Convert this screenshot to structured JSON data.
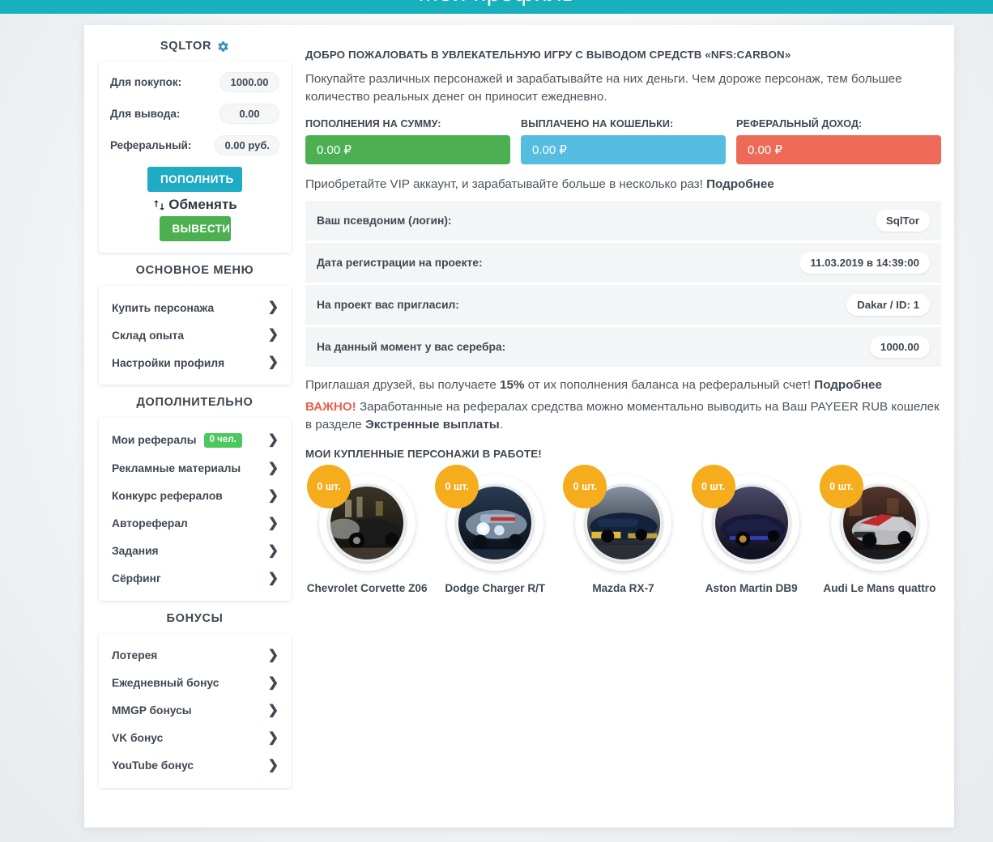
{
  "header": {
    "title": "Мой профиль",
    "accent_color": "#18b0bd"
  },
  "sidebar": {
    "brand": {
      "name": "SQLTOR",
      "gear_icon": "gear-icon"
    },
    "balance": {
      "rows": [
        {
          "label": "Для покупок:",
          "value": "1000.00"
        },
        {
          "label": "Для вывода:",
          "value": "0.00"
        },
        {
          "label": "Реферальный:",
          "value": "0.00 руб."
        }
      ],
      "topup_button": "ПОПОЛНИТЬ",
      "exchange_link": "Обменять",
      "withdraw_button": "ВЫВЕСТИ"
    },
    "sections": [
      {
        "title": "ОСНОВНОЕ МЕНЮ",
        "items": [
          {
            "label": "Купить персонажа"
          },
          {
            "label": "Склад опыта"
          },
          {
            "label": "Настройки профиля"
          }
        ]
      },
      {
        "title": "ДОПОЛНИТЕЛЬНО",
        "items": [
          {
            "label": "Мои рефералы",
            "badge": "0 чел."
          },
          {
            "label": "Рекламные материалы"
          },
          {
            "label": "Конкурс рефералов"
          },
          {
            "label": "Автореферал"
          },
          {
            "label": "Задания"
          },
          {
            "label": "Сёрфинг"
          }
        ]
      },
      {
        "title": "БОНУСЫ",
        "items": [
          {
            "label": "Лотерея"
          },
          {
            "label": "Ежедневный бонус"
          },
          {
            "label": "MMGP бонусы"
          },
          {
            "label": "VK бонус"
          },
          {
            "label": "YouTube бонус"
          }
        ]
      }
    ]
  },
  "main": {
    "welcome_title": "ДОБРО ПОЖАЛОВАТЬ В УВЛЕКАТЕЛЬНУЮ ИГРУ С ВЫВОДОМ СРЕДСТВ «NFS:CARBON»",
    "lead": "Покупайте различных персонажей и зарабатывайте на них деньги. Чем дороже персонаж, тем большее количество реальных денег он приносит ежедневно.",
    "stats": [
      {
        "label": "ПОПОЛНЕНИЯ НА СУММУ:",
        "value": "0.00 ₽",
        "color": "#4cb053"
      },
      {
        "label": "ВЫПЛАЧЕНО НА КОШЕЛЬКИ:",
        "value": "0.00 ₽",
        "color": "#56bde0"
      },
      {
        "label": "РЕФЕРАЛЬНЫЙ ДОХОД:",
        "value": "0.00 ₽",
        "color": "#ec6a57"
      }
    ],
    "vip_text": "Приобретайте VIP аккаунт, и зарабатывайте больше в несколько раз! ",
    "vip_link": "Подробнее",
    "info_rows": [
      {
        "label": "Ваш псевдоним (логин):",
        "value": "SqlTor"
      },
      {
        "label": "Дата регистрации на проекте:",
        "value": "11.03.2019 в 14:39:00"
      },
      {
        "label": "На проект вас пригласил:",
        "value": "Dakar / ID: 1"
      },
      {
        "label": "На данный момент у вас серебра:",
        "value": "1000.00"
      }
    ],
    "ref_text_a": "Приглашая друзей, вы получаете ",
    "ref_percent": "15%",
    "ref_text_b": " от их пополнения баланса на реферальный счет! ",
    "ref_link": "Подробнее",
    "important_badge": "ВАЖНО!",
    "important_text_a": " Заработанные на рефералах средства можно моментально выводить на Ваш PAYEER RUB кошелек в разделе ",
    "important_link": "Экстренные выплаты",
    "important_text_b": ".",
    "cars_title": "МОИ КУПЛЕННЫЕ ПЕРСОНАЖИ В РАБОТЕ!",
    "cars": [
      {
        "name": "Chevrolet Corvette Z06",
        "qty": "0 шт.",
        "tone_a": "#3a3326",
        "tone_b": "#100e0b",
        "body": "#1b1b1b",
        "accent": "#d9cfa8"
      },
      {
        "name": "Dodge Charger R/T",
        "qty": "0 шт.",
        "tone_a": "#2a3b52",
        "tone_b": "#070c14",
        "body": "#7d90a6",
        "accent": "#cfe6ff"
      },
      {
        "name": "Mazda RX-7",
        "qty": "0 шт.",
        "tone_a": "#33404f",
        "tone_b": "#0a0d12",
        "body": "#13213a",
        "accent": "#e2b93a"
      },
      {
        "name": "Aston Martin DB9",
        "qty": "0 шт.",
        "tone_a": "#3b3a54",
        "tone_b": "#0b0a14",
        "body": "#17183a",
        "accent": "#3a49c9"
      },
      {
        "name": "Audi Le Mans quattro",
        "qty": "0 шт.",
        "tone_a": "#4a2a26",
        "tone_b": "#0d0a09",
        "body": "#b7b9bd",
        "accent": "#c02a2a"
      }
    ]
  }
}
